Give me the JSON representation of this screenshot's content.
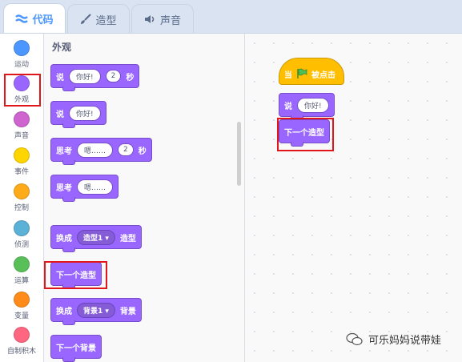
{
  "tabs": [
    {
      "label": "代码",
      "icon": "code-icon"
    },
    {
      "label": "造型",
      "icon": "brush-icon"
    },
    {
      "label": "声音",
      "icon": "speaker-icon"
    }
  ],
  "categories": [
    {
      "label": "运动",
      "color": "#4c97ff"
    },
    {
      "label": "外观",
      "color": "#9966ff"
    },
    {
      "label": "声音",
      "color": "#cf63cf"
    },
    {
      "label": "事件",
      "color": "#ffd500"
    },
    {
      "label": "控制",
      "color": "#ffab19"
    },
    {
      "label": "侦测",
      "color": "#5cb1d6"
    },
    {
      "label": "运算",
      "color": "#59c059"
    },
    {
      "label": "变量",
      "color": "#ff8c1a"
    },
    {
      "label": "自制积木",
      "color": "#ff6680"
    }
  ],
  "palette": {
    "title": "外观",
    "blocks": {
      "say_for": {
        "say": "说",
        "text": "你好!",
        "secs": "2",
        "unit": "秒"
      },
      "say": {
        "say": "说",
        "text": "你好!"
      },
      "think_for": {
        "think": "思考",
        "text": "嗯……",
        "secs": "2",
        "unit": "秒"
      },
      "think": {
        "think": "思考",
        "text": "嗯……"
      },
      "switch_costume": {
        "pre": "换成",
        "value": "造型1",
        "post": "造型"
      },
      "next_costume": {
        "label": "下一个造型"
      },
      "switch_backdrop": {
        "pre": "换成",
        "value": "背景1",
        "post": "背景"
      },
      "next_backdrop": {
        "label": "下一个背景"
      }
    }
  },
  "script": {
    "hat": {
      "pre": "当",
      "post": "被点击"
    },
    "say": {
      "say": "说",
      "text": "你好!"
    },
    "next": {
      "label": "下一个造型"
    }
  },
  "watermark": "可乐妈妈说带娃",
  "colors": {
    "looks": "#9966ff",
    "events": "#ffbf00",
    "highlight": "#e0161b",
    "accent": "#4c97ff"
  }
}
